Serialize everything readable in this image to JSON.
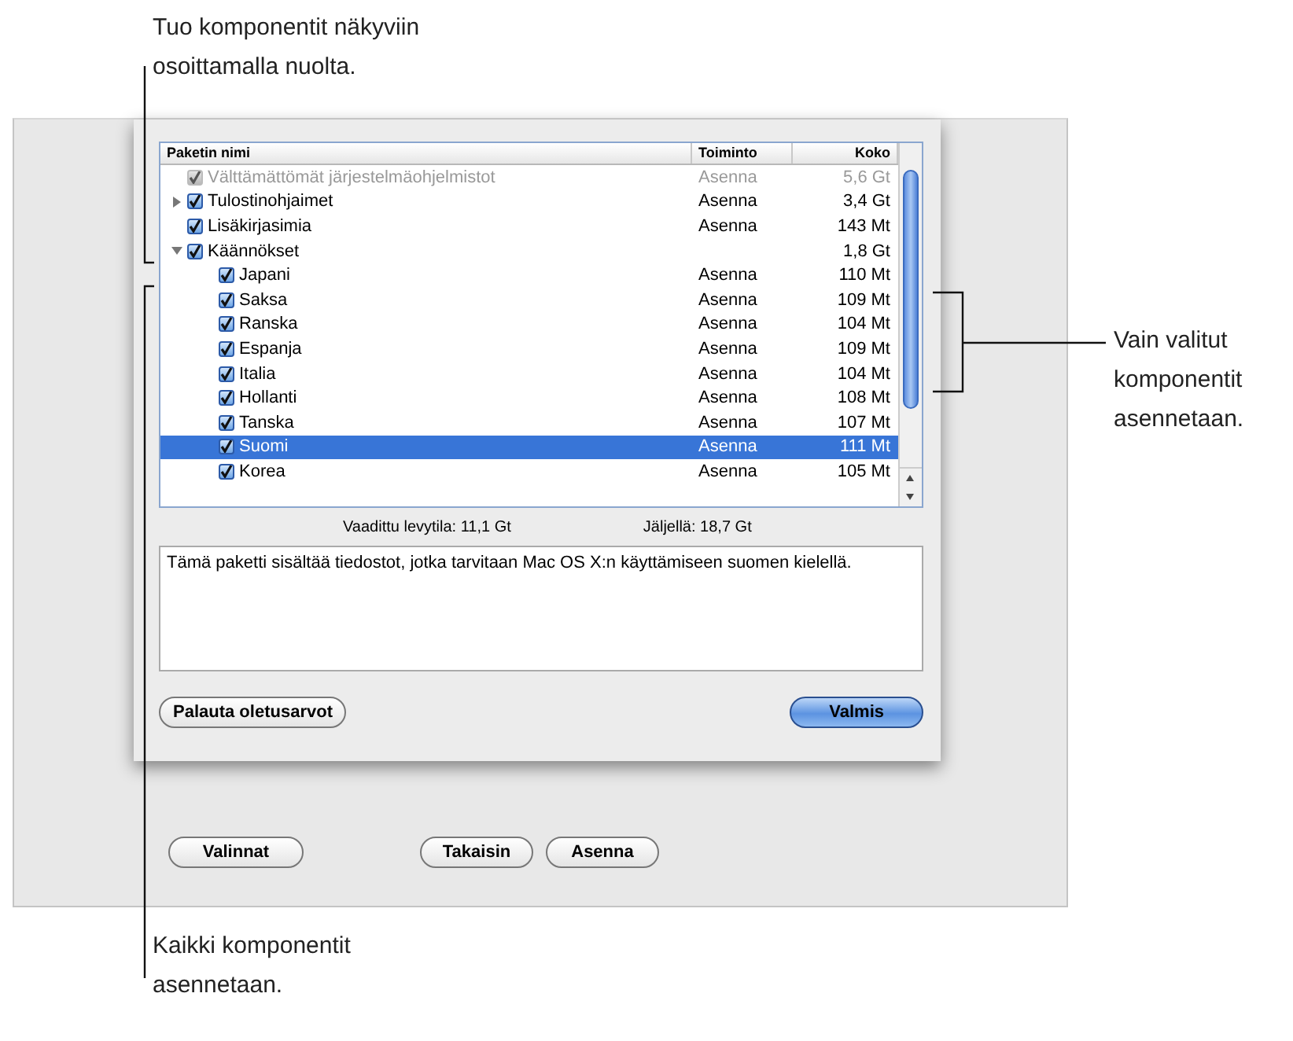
{
  "callouts": {
    "top": "Tuo komponentit näkyviin osoittamalla nuolta.",
    "right": "Vain valitut komponentit asennetaan.",
    "bottom": "Kaikki komponentit asennetaan."
  },
  "sheet": {
    "table": {
      "columns": [
        "Paketin nimi",
        "Toiminto",
        "Koko"
      ],
      "rows": [
        {
          "name": "Välttämättömät järjestelmäohjelmistot",
          "action": "Asenna",
          "size": "5,6 Gt",
          "checked": true,
          "disabled": true,
          "selected": false
        },
        {
          "name": "Tulostinohjaimet",
          "action": "Asenna",
          "size": "3,4 Gt",
          "checked": true,
          "disabled": false,
          "selected": false,
          "expanded": false
        },
        {
          "name": "Lisäkirjasimia",
          "action": "Asenna",
          "size": "143 Mt",
          "checked": true,
          "disabled": false,
          "selected": false
        },
        {
          "name": "Käännökset",
          "size": "1,8 Gt",
          "checked": true,
          "disabled": false,
          "selected": false,
          "expanded": true,
          "children": [
            {
              "name": "Japani",
              "action": "Asenna",
              "size": "110 Mt",
              "checked": true,
              "disabled": false,
              "selected": false
            },
            {
              "name": "Saksa",
              "action": "Asenna",
              "size": "109 Mt",
              "checked": true,
              "disabled": false,
              "selected": false
            },
            {
              "name": "Ranska",
              "action": "Asenna",
              "size": "104 Mt",
              "checked": true,
              "disabled": false,
              "selected": false
            },
            {
              "name": "Espanja",
              "action": "Asenna",
              "size": "109 Mt",
              "checked": true,
              "disabled": false,
              "selected": false
            },
            {
              "name": "Italia",
              "action": "Asenna",
              "size": "104 Mt",
              "checked": true,
              "disabled": false,
              "selected": false
            },
            {
              "name": "Hollanti",
              "action": "Asenna",
              "size": "108 Mt",
              "checked": true,
              "disabled": false,
              "selected": false
            },
            {
              "name": "Tanska",
              "action": "Asenna",
              "size": "107 Mt",
              "checked": true,
              "disabled": false,
              "selected": false
            },
            {
              "name": "Suomi",
              "action": "Asenna",
              "size": "111 Mt",
              "checked": true,
              "disabled": false,
              "selected": true
            },
            {
              "name": "Korea",
              "action": "Asenna",
              "size": "105 Mt",
              "checked": true,
              "disabled": false,
              "selected": false
            }
          ]
        }
      ]
    },
    "required_space": "Vaadittu levytila: 11,1 Gt",
    "remaining_space": "Jäljellä: 18,7 Gt",
    "description": "Tämä paketti sisältää tiedostot, jotka tarvitaan Mac OS X:n käyttämiseen suomen kielellä.",
    "buttons": [
      {
        "label": "Palauta oletusarvot",
        "kind": "normal"
      },
      {
        "label": "Valmis",
        "kind": "default"
      }
    ]
  },
  "window_buttons": [
    "Valinnat",
    "Takaisin",
    "Asenna"
  ]
}
